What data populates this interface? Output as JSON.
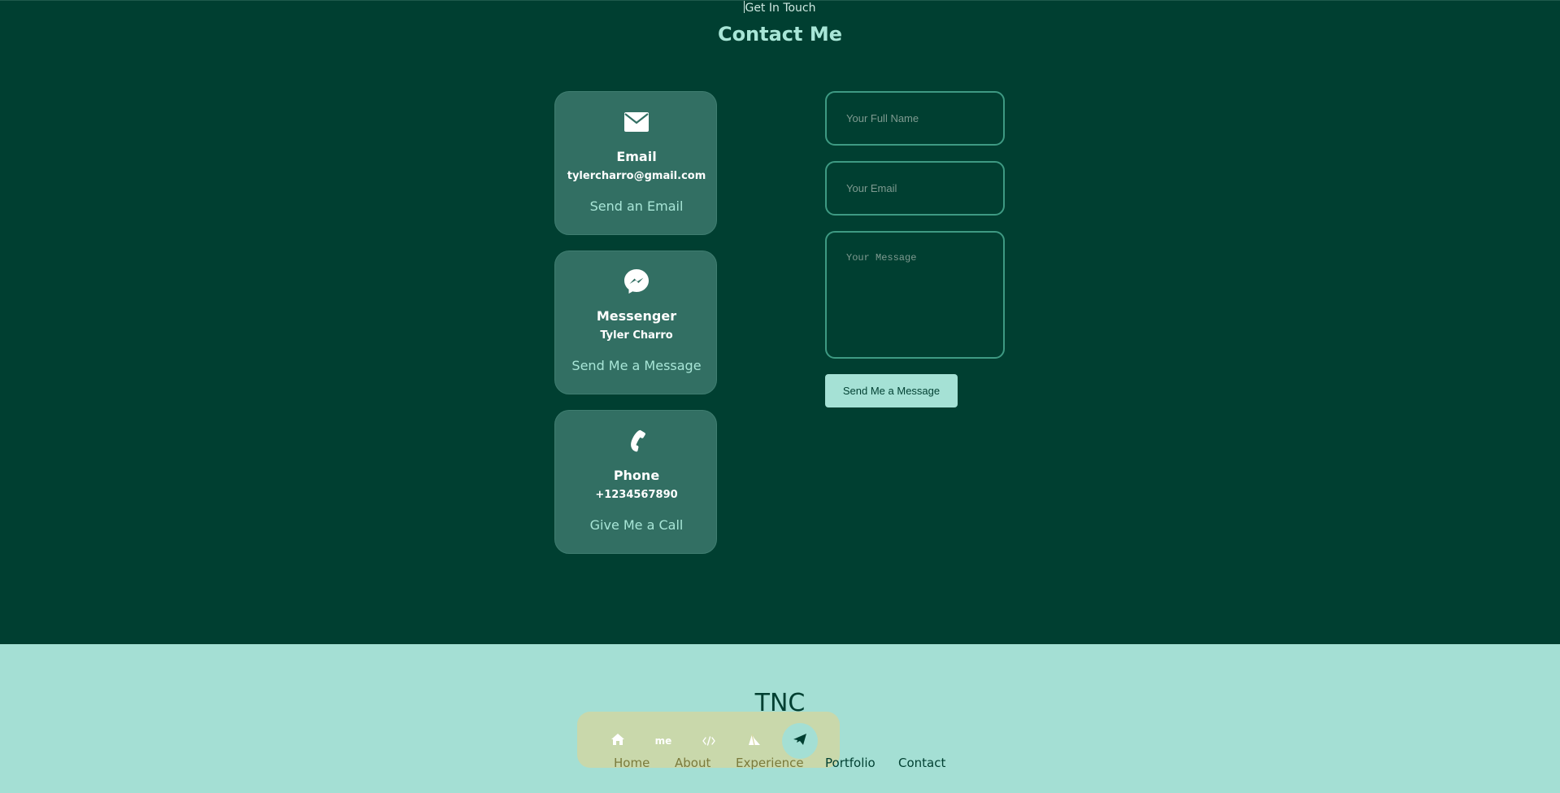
{
  "header": {
    "eyebrow": "Get In Touch",
    "title": "Contact Me"
  },
  "cards": [
    {
      "icon": "envelope-icon",
      "title": "Email",
      "value": "tylercharro@gmail.com",
      "link": "Send an Email"
    },
    {
      "icon": "messenger-icon",
      "title": "Messenger",
      "value": "Tyler Charro",
      "link": "Send Me a Message"
    },
    {
      "icon": "phone-icon",
      "title": "Phone",
      "value": "+1234567890",
      "link": "Give Me a Call"
    }
  ],
  "form": {
    "name_placeholder": "Your Full Name",
    "email_placeholder": "Your Email",
    "message_placeholder": "Your Message",
    "submit_label": "Send Me a Message"
  },
  "footer": {
    "logo": "TNC",
    "nav_icons": [
      "home-icon",
      "me-icon",
      "code-icon",
      "experience-icon",
      "send-icon"
    ],
    "nav_icon_me_text": "me",
    "active_icon": "send-icon",
    "links": [
      "Home",
      "About",
      "Experience",
      "Portfolio",
      "Contact"
    ]
  },
  "colors": {
    "background": "#003f31",
    "card": "#326f63",
    "accent": "#a8e6d7",
    "footer": "#a4dfd4",
    "dock": "#d6d69d"
  }
}
